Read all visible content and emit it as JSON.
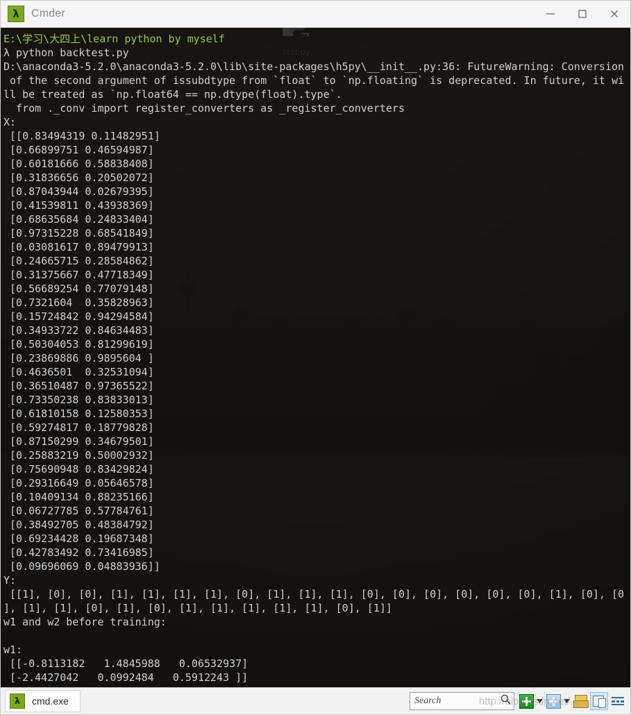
{
  "desktop": {
    "icon": {
      "label": "test.py",
      "icon": "python-file-icon"
    }
  },
  "window": {
    "title": "Cmder",
    "app_icon": "lambda-icon",
    "controls": {
      "minimize": "minimize-icon",
      "maximize": "maximize-icon",
      "close": "close-icon"
    }
  },
  "terminal": {
    "prompt_path": "E:\\学习\\大四上\\learn python by myself",
    "prompt_symbol": "λ",
    "command": "python backtest.py",
    "lines": [
      {
        "text": "E:\\学习\\大四上\\learn python by myself",
        "color": "green"
      },
      {
        "text": "λ python backtest.py",
        "color": "grey"
      },
      {
        "text": "D:\\anaconda3-5.2.0\\anaconda3-5.2.0\\lib\\site-packages\\h5py\\__init__.py:36: FutureWarning: Conversion",
        "color": "grey"
      },
      {
        "text": " of the second argument of issubdtype from `float` to `np.floating` is deprecated. In future, it wi",
        "color": "grey"
      },
      {
        "text": "ll be treated as `np.float64 == np.dtype(float).type`.",
        "color": "grey"
      },
      {
        "text": "  from ._conv import register_converters as _register_converters",
        "color": "grey"
      },
      {
        "text": "X:",
        "color": "grey"
      },
      {
        "text": " [[0.83494319 0.11482951]",
        "color": "grey"
      },
      {
        "text": " [0.66899751 0.46594987]",
        "color": "grey"
      },
      {
        "text": " [0.60181666 0.58838408]",
        "color": "grey"
      },
      {
        "text": " [0.31836656 0.20502072]",
        "color": "grey"
      },
      {
        "text": " [0.87043944 0.02679395]",
        "color": "grey"
      },
      {
        "text": " [0.41539811 0.43938369]",
        "color": "grey"
      },
      {
        "text": " [0.68635684 0.24833404]",
        "color": "grey"
      },
      {
        "text": " [0.97315228 0.68541849]",
        "color": "grey"
      },
      {
        "text": " [0.03081617 0.89479913]",
        "color": "grey"
      },
      {
        "text": " [0.24665715 0.28584862]",
        "color": "grey"
      },
      {
        "text": " [0.31375667 0.47718349]",
        "color": "grey"
      },
      {
        "text": " [0.56689254 0.77079148]",
        "color": "grey"
      },
      {
        "text": " [0.7321604  0.35828963]",
        "color": "grey"
      },
      {
        "text": " [0.15724842 0.94294584]",
        "color": "grey"
      },
      {
        "text": " [0.34933722 0.84634483]",
        "color": "grey"
      },
      {
        "text": " [0.50304053 0.81299619]",
        "color": "grey"
      },
      {
        "text": " [0.23869886 0.9895604 ]",
        "color": "grey"
      },
      {
        "text": " [0.4636501  0.32531094]",
        "color": "grey"
      },
      {
        "text": " [0.36510487 0.97365522]",
        "color": "grey"
      },
      {
        "text": " [0.73350238 0.83833013]",
        "color": "grey"
      },
      {
        "text": " [0.61810158 0.12580353]",
        "color": "grey"
      },
      {
        "text": " [0.59274817 0.18779828]",
        "color": "grey"
      },
      {
        "text": " [0.87150299 0.34679501]",
        "color": "grey"
      },
      {
        "text": " [0.25883219 0.50002932]",
        "color": "grey"
      },
      {
        "text": " [0.75690948 0.83429824]",
        "color": "grey"
      },
      {
        "text": " [0.29316649 0.05646578]",
        "color": "grey"
      },
      {
        "text": " [0.10409134 0.88235166]",
        "color": "grey"
      },
      {
        "text": " [0.06727785 0.57784761]",
        "color": "grey"
      },
      {
        "text": " [0.38492705 0.48384792]",
        "color": "grey"
      },
      {
        "text": " [0.69234428 0.19687348]",
        "color": "grey"
      },
      {
        "text": " [0.42783492 0.73416985]",
        "color": "grey"
      },
      {
        "text": " [0.09696069 0.04883936]]",
        "color": "grey"
      },
      {
        "text": "Y:",
        "color": "grey"
      },
      {
        "text": " [[1], [0], [0], [1], [1], [1], [1], [0], [1], [1], [1], [0], [0], [0], [0], [0], [0], [1], [0], [0",
        "color": "grey"
      },
      {
        "text": "], [1], [1], [0], [1], [0], [1], [1], [1], [1], [1], [0], [1]]",
        "color": "grey"
      },
      {
        "text": "w1 and w2 before training:",
        "color": "grey"
      },
      {
        "text": "",
        "color": "grey"
      },
      {
        "text": "w1:",
        "color": "grey"
      },
      {
        "text": " [[-0.8113182   1.4845988   0.06532937]",
        "color": "grey"
      },
      {
        "text": " [-2.4427042   0.0992484   0.5912243 ]]",
        "color": "grey"
      }
    ]
  },
  "statusbar": {
    "tab": {
      "label": "cmd.exe",
      "icon": "lambda-icon"
    },
    "search": {
      "placeholder": "Search",
      "icon": "magnifier-icon"
    },
    "buttons": [
      {
        "name": "new-console-button",
        "icon": "green-plus-icon"
      },
      {
        "name": "new-console-dropdown",
        "icon": "chevron-down-icon"
      },
      {
        "name": "new-tab-button",
        "icon": "blue-plus-icon"
      },
      {
        "name": "new-tab-dropdown",
        "icon": "chevron-down-icon"
      },
      {
        "name": "toolbar-group-button",
        "icon": "gold-stack-icon"
      },
      {
        "name": "window-layout-button",
        "icon": "window-panes-icon"
      },
      {
        "name": "status-grid-button",
        "icon": "grid-icon"
      }
    ]
  },
  "watermark": {
    "text": "http://blog.csdn.net/..."
  },
  "colors": {
    "accent_green": "#7aa822",
    "prompt_green": "#9ec448",
    "terminal_fg": "#cccccc",
    "terminal_bg": "#14120f",
    "titlebar_bg": "#f5f5f5"
  }
}
